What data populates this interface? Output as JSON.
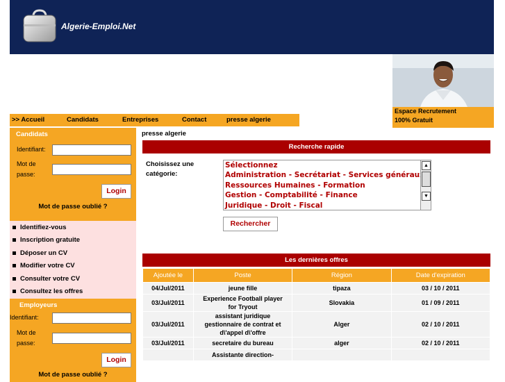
{
  "site": {
    "name": "Algerie-Emploi.Net"
  },
  "promo": {
    "line1": "Espace Recrutement",
    "line2": "100% Gratuit"
  },
  "nav": [
    ">> Accueil",
    "Candidats",
    "Entreprises",
    "Contact",
    "presse algerie"
  ],
  "candidats": {
    "title": "Candidats",
    "id_label": "Identifiant:",
    "pwd_label_1": "Mot de",
    "pwd_label_2": "passe:",
    "login": "Login",
    "forgot": "Mot de passe oublié ?",
    "links": [
      "Identifiez-vous",
      "Inscription gratuite",
      "Déposer un CV",
      "Modifier votre CV",
      "Consulter votre CV",
      "Consultez les offres"
    ]
  },
  "employeurs": {
    "title": "Employeurs",
    "id_label": "Identifiant:",
    "pwd_label_1": "Mot de",
    "pwd_label_2": "passe:",
    "login": "Login",
    "forgot": "Mot de passe oublié ?"
  },
  "breadcrumb": "presse algerie",
  "search": {
    "title": "Recherche rapide",
    "label": "Choisissez une catégorie:",
    "options": [
      "Sélectionnez",
      "Administration - Secrétariat - Services généraux",
      "Ressources Humaines - Formation",
      "Gestion - Comptabilité - Finance",
      "Juridique - Droit - Fiscal"
    ],
    "button": "Rechercher"
  },
  "offers": {
    "title": "Les dernières offres",
    "headers": [
      "Ajoutée le",
      "Poste",
      "Région",
      "Date d'expiration"
    ],
    "rows": [
      [
        "04/Jul/2011",
        "jeune fille",
        "tipaza",
        "03 / 10 / 2011"
      ],
      [
        "03/Jul/2011",
        "Experience Football player for Tryout",
        "Slovakia",
        "01 / 09 / 2011"
      ],
      [
        "03/Jul/2011",
        "assistant juridique gestionnaire de contrat et d\\'appel d\\'offre",
        "Alger",
        "02 / 10 / 2011"
      ],
      [
        "03/Jul/2011",
        "secretaire du bureau",
        "alger",
        "02 / 10 / 2011"
      ],
      [
        "",
        "Assistante direction-",
        "",
        ""
      ]
    ]
  },
  "colors": {
    "header": "#0f2356",
    "accent": "#f5a623",
    "red": "#aa0000",
    "pink": "#fde0e0"
  }
}
